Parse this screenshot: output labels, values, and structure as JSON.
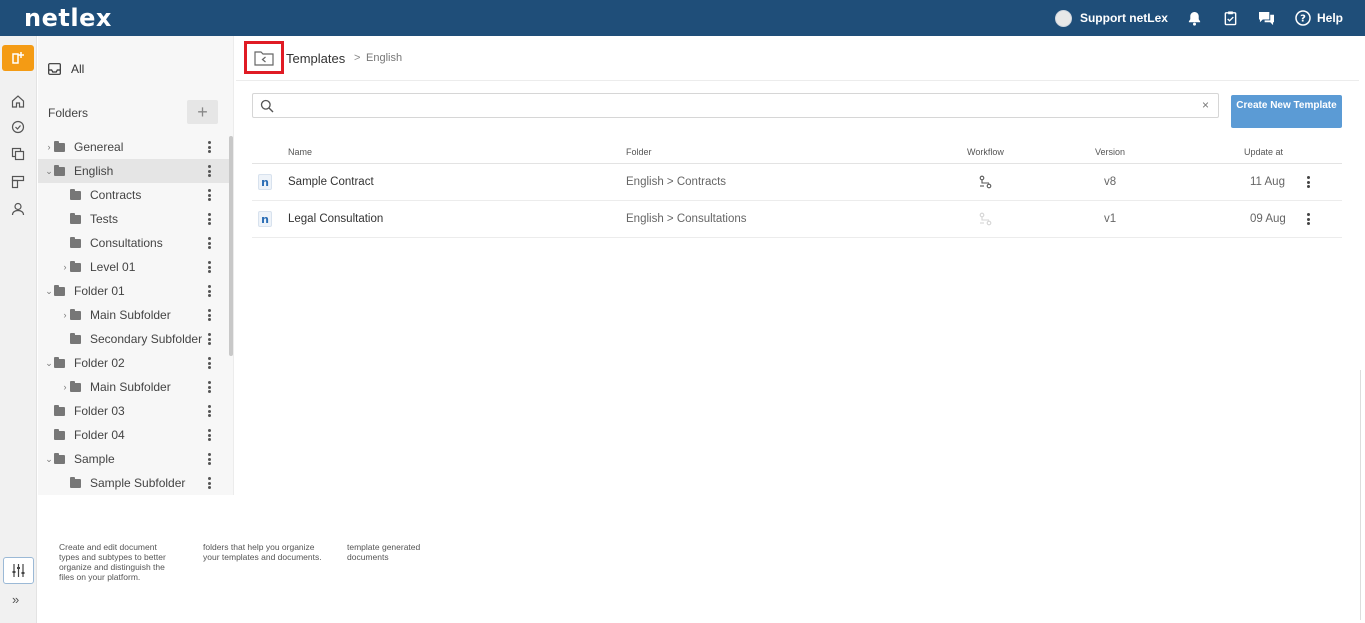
{
  "app": {
    "logo": "netlex"
  },
  "topbar": {
    "user_name": "Support netLex",
    "help_label": "Help",
    "icons": [
      "bell-icon",
      "clipboard-check-icon",
      "chat-icon",
      "question-circle-icon"
    ]
  },
  "rail": {
    "icons": [
      "new-template-icon",
      "home-icon",
      "dashboard-icon",
      "copy-icon",
      "board-icon",
      "user-icon",
      "sliders-icon",
      "expand-icon"
    ],
    "expand_label": "»",
    "accent_color": "#f49b14"
  },
  "sidebar": {
    "all_label": "All",
    "folders_label": "Folders",
    "add_label": "+",
    "tree": [
      {
        "label": "Genereal",
        "chevron": "›"
      },
      {
        "label": "English",
        "chevron": "⌄"
      },
      {
        "label": "Contracts",
        "chevron": ""
      },
      {
        "label": "Tests",
        "chevron": ""
      },
      {
        "label": "Consultations",
        "chevron": ""
      },
      {
        "label": "Level 01",
        "chevron": "›"
      },
      {
        "label": "Folder 01",
        "chevron": "⌄"
      },
      {
        "label": "Main Subfolder",
        "chevron": "›"
      },
      {
        "label": "Secondary Subfolder",
        "chevron": ""
      },
      {
        "label": "Folder 02",
        "chevron": "⌄"
      },
      {
        "label": "Main Subfolder",
        "chevron": "›"
      },
      {
        "label": "Folder 03",
        "chevron": ""
      },
      {
        "label": "Folder 04",
        "chevron": ""
      },
      {
        "label": "Sample",
        "chevron": "⌄"
      },
      {
        "label": "Sample Subfolder",
        "chevron": ""
      }
    ]
  },
  "footer": {
    "text1": "Create and edit document types and subtypes to better organize and distinguish the files on your platform.",
    "text2": "folders that help you organize your templates and documents.",
    "text3": "template generated documents"
  },
  "breadcrumb": {
    "title": "Templates",
    "separator": ">",
    "current": "English"
  },
  "search": {
    "placeholder": "",
    "value": "",
    "clear_label": "×"
  },
  "create_button": {
    "label": "Create New Template",
    "color": "#5b9bd5"
  },
  "table": {
    "headers": {
      "name": "Name",
      "folder": "Folder",
      "workflow": "Workflow",
      "version": "Version",
      "updated": "Update at"
    },
    "rows": [
      {
        "icon_letter": "n",
        "name": "Sample Contract",
        "folder_root": "English",
        "folder_sep": ">",
        "folder_sub": "Contracts",
        "version": "v8",
        "updated": "11 Aug",
        "workflow_active": true
      },
      {
        "icon_letter": "n",
        "name": "Legal Consultation",
        "folder_root": "English",
        "folder_sep": ">",
        "folder_sub": "Consultations",
        "version": "v1",
        "updated": "09 Aug",
        "workflow_active": false
      }
    ]
  }
}
